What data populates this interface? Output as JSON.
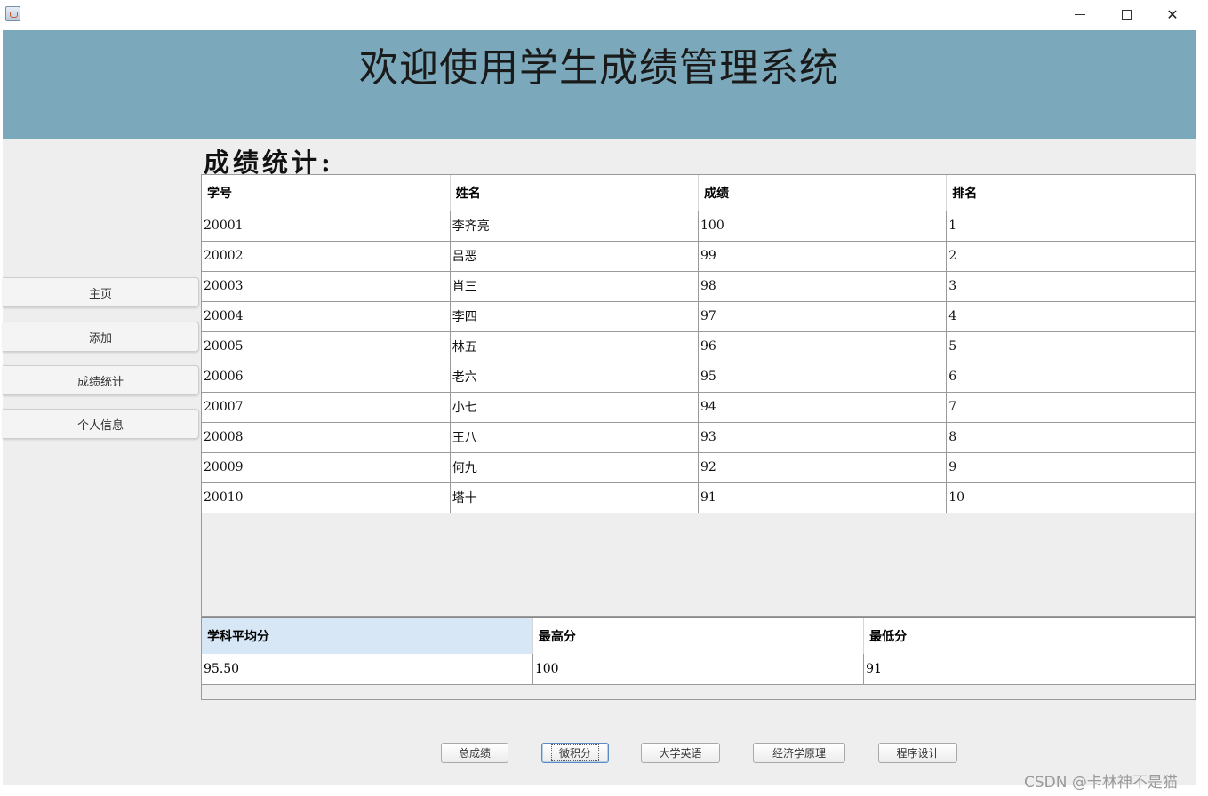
{
  "window": {
    "minimize_glyph": "—",
    "maximize_glyph": "☐",
    "close_glyph": "✕"
  },
  "header": {
    "title": "欢迎使用学生成绩管理系统"
  },
  "sidebar": {
    "items": [
      {
        "label": "主页"
      },
      {
        "label": "添加"
      },
      {
        "label": "成绩统计"
      },
      {
        "label": "个人信息"
      }
    ]
  },
  "main": {
    "section_title": "成绩统计:",
    "columns": [
      "学号",
      "姓名",
      "成绩",
      "排名"
    ],
    "rows": [
      [
        "20001",
        "李齐亮",
        "100",
        "1"
      ],
      [
        "20002",
        "吕恶",
        "99",
        "2"
      ],
      [
        "20003",
        "肖三",
        "98",
        "3"
      ],
      [
        "20004",
        "李四",
        "97",
        "4"
      ],
      [
        "20005",
        "林五",
        "96",
        "5"
      ],
      [
        "20006",
        "老六",
        "95",
        "6"
      ],
      [
        "20007",
        "小七",
        "94",
        "7"
      ],
      [
        "20008",
        "王八",
        "93",
        "8"
      ],
      [
        "20009",
        "何九",
        "92",
        "9"
      ],
      [
        "20010",
        "塔十",
        "91",
        "10"
      ]
    ],
    "stats": {
      "columns": [
        "学科平均分",
        "最高分",
        "最低分"
      ],
      "values": [
        "95.50",
        "100",
        "91"
      ]
    },
    "subject_buttons": [
      {
        "label": "总成绩"
      },
      {
        "label": "微积分"
      },
      {
        "label": "大学英语"
      },
      {
        "label": "经济学原理"
      },
      {
        "label": "程序设计"
      }
    ]
  },
  "watermark": "CSDN @卡林神不是猫"
}
